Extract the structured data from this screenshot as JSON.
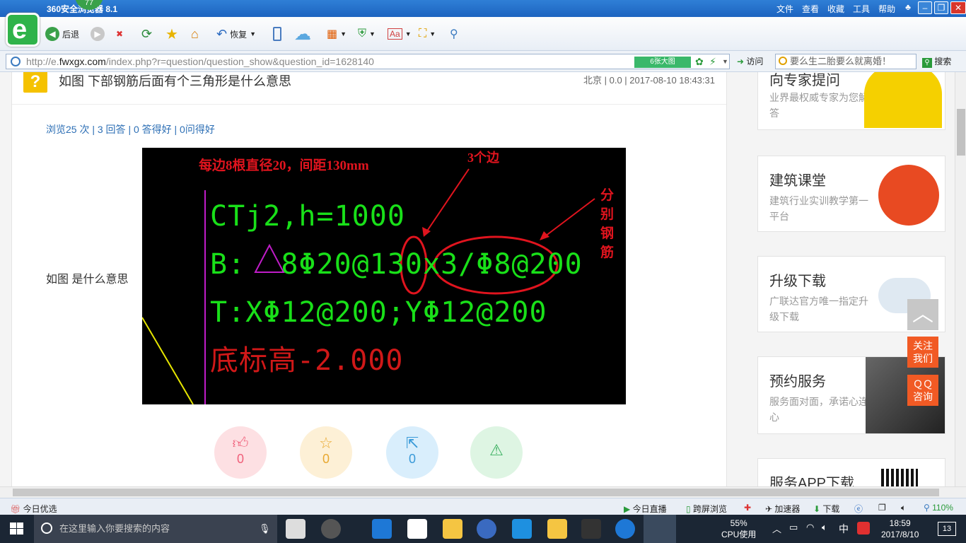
{
  "window": {
    "title": "360安全浏览器 8.1",
    "badge": "77",
    "menu": [
      "文件",
      "查看",
      "收藏",
      "工具",
      "帮助"
    ]
  },
  "toolbar": {
    "back": "后退",
    "restore": "恢复"
  },
  "address": {
    "prefix": "http://e.",
    "host": "fwxgx.com",
    "path": "/index.php?r=question/question_show&question_id=1628140",
    "big_image": "6张大图",
    "visit": "访问",
    "search_placeholder": "要么生二胎要么就离婚！",
    "search_button": "搜索"
  },
  "question": {
    "title": "如图 下部钢筋后面有个三角形是什么意思",
    "meta": "北京 | 0.0 | 2017-08-10 18:43:31",
    "stats": "浏览25 次 | 3 回答 | 0 答得好 | 0问得好",
    "body": "如图  是什么意思",
    "actions": {
      "like": "0",
      "favorite": "0",
      "share": "0"
    }
  },
  "cad": {
    "annotation_top": "每边8根直径20，间距130mm",
    "annotation_sides": "3个边",
    "annotation_separate": "分别钢筋",
    "line1": "CTj2,h=1000",
    "line2": "B:  8Φ20@130x3/Φ8@200",
    "line3": "T:XΦ12@200;YΦ12@200",
    "line4": "底标高-2.000"
  },
  "sidebar": [
    {
      "title": "向专家提问",
      "desc": "业界最权威专家为您解答"
    },
    {
      "title": "建筑课堂",
      "desc": "建筑行业实训教学第一平台"
    },
    {
      "title": "升级下载",
      "desc": "广联达官方唯一指定升级下载"
    },
    {
      "title": "预约服务",
      "desc": "服务面对面，承诺心连心"
    },
    {
      "title": "服务APP下载",
      "desc": ""
    }
  ],
  "float": {
    "follow": "关注\n我们",
    "qq": "ＱＱ\n咨询"
  },
  "statusbar": {
    "left": "今日优选",
    "live": "今日直播",
    "cross": "跨屏浏览",
    "accel": "加速器",
    "download": "下载",
    "zoom": "110%"
  },
  "taskbar": {
    "search": "在这里输入你要搜索的内容",
    "cpu_pct": "55%",
    "cpu_label": "CPU使用",
    "ime": "中",
    "time": "18:59",
    "date": "2017/8/10",
    "notify": "13"
  },
  "colors": {
    "green": "#19e019",
    "red": "#e0141e",
    "magenta": "#c01cc8",
    "accent_blue": "#2d6fb5"
  }
}
